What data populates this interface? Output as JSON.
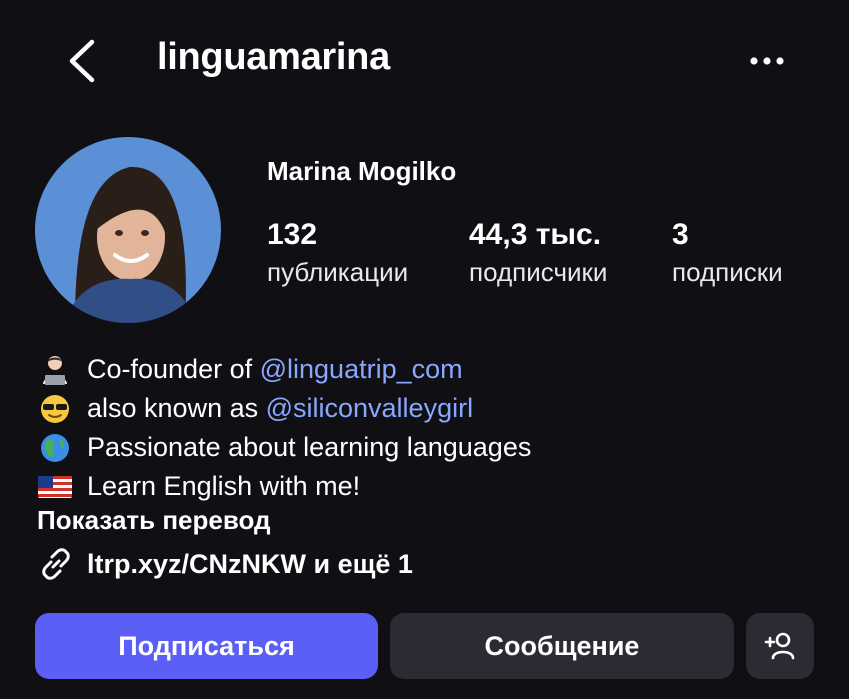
{
  "header": {
    "username": "linguamarina",
    "back_icon": "chevron-left-icon",
    "more_icon": "more-horizontal-icon"
  },
  "profile": {
    "full_name": "Marina Mogilko",
    "stats": {
      "posts": {
        "value": "132",
        "label": "публикации"
      },
      "followers": {
        "value": "44,3 тыс.",
        "label": "подписчики"
      },
      "following": {
        "value": "3",
        "label": "подписки"
      }
    }
  },
  "bio": {
    "line1_text": "Co-founder of ",
    "line1_mention": "@linguatrip_com",
    "line2_text": "also known as ",
    "line2_mention": "@siliconvalleygirl",
    "line3_text": "Passionate about learning languages",
    "line4_text": "Learn English with me!",
    "show_translation": "Показать перевод",
    "link_text": "ltrp.xyz/CNzNKW и ещё 1"
  },
  "actions": {
    "follow": "Подписаться",
    "message": "Сообщение",
    "add_user_icon": "add-user-icon"
  },
  "colors": {
    "background": "#0f0f14",
    "accent": "#5b5ff5",
    "mention": "#8aa7ff",
    "secondary_button": "#2a2b33"
  }
}
